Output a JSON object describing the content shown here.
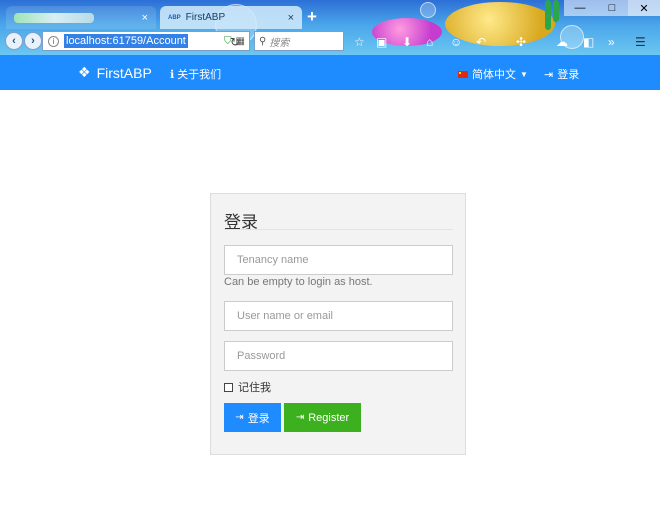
{
  "browser": {
    "active_tab": {
      "favicon": "ABP",
      "title": "FirstABP"
    },
    "url": "localhost:61759/Account",
    "search_placeholder": "搜索",
    "tab_close_glyph": "×",
    "new_tab_glyph": "+"
  },
  "navbar": {
    "brand": "FirstABP",
    "about_label": "关于我们",
    "language_label": "简体中文",
    "login_label": "登录"
  },
  "login_form": {
    "title": "登录",
    "tenancy_placeholder": "Tenancy name",
    "tenancy_help": "Can be empty to login as host.",
    "username_placeholder": "User name or email",
    "password_placeholder": "Password",
    "remember_label": "记住我",
    "login_button": "登录",
    "register_button": "Register"
  },
  "colors": {
    "navbar_blue": "#1e8bff",
    "register_green": "#3cb01e",
    "card_bg": "#f3f3f3"
  },
  "icons": {
    "brand": "cubes-icon",
    "about": "info-icon",
    "language": "china-flag-icon",
    "login": "sign-in-icon"
  }
}
